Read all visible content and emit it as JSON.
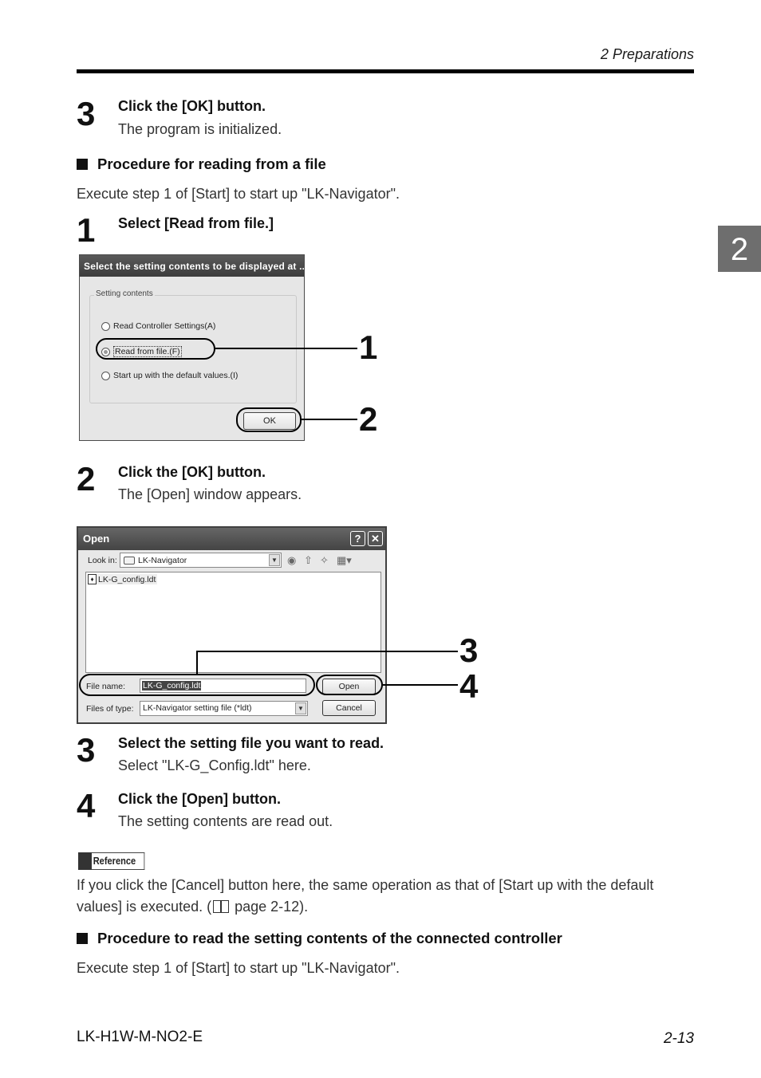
{
  "header": {
    "running_title": "2  Preparations"
  },
  "chapter_tab": {
    "number": "2"
  },
  "steps_top": [
    {
      "number": "3",
      "title": "Click the [OK] button.",
      "desc": "The program is initialized."
    }
  ],
  "section_file": {
    "heading": "Procedure for reading from a file",
    "intro": "Execute step 1 of [Start] to start up \"LK-Navigator\".",
    "step1": {
      "number": "1",
      "title": "Select [Read from file.]"
    },
    "step2": {
      "number": "2",
      "title": "Click the [OK] button.",
      "desc": "The [Open] window appears."
    },
    "step3": {
      "number": "3",
      "title": "Select the setting file you want to read.",
      "desc": "Select \"LK-G_Config.ldt\" here."
    },
    "step4": {
      "number": "4",
      "title": "Click the [Open] button.",
      "desc": "The setting contents are read out."
    }
  },
  "dialog_select": {
    "title": "Select the setting contents to be displayed at ...",
    "group_label": "Setting contents",
    "options": [
      {
        "label": "Read Controller Settings(A)",
        "checked": false
      },
      {
        "label": "Read from file.(F)",
        "checked": true
      },
      {
        "label": "Start up with the default values.(I)",
        "checked": false
      }
    ],
    "ok_label": "OK",
    "callouts": [
      "1",
      "2"
    ]
  },
  "dialog_open": {
    "title": "Open",
    "help_btn": "?",
    "close_btn": "✕",
    "look_in_label": "Look in:",
    "look_in_value": "LK-Navigator",
    "files": [
      "LK-G_config.ldt"
    ],
    "file_name_label": "File name:",
    "file_name_value": "LK-G_config.ldt",
    "file_type_label": "Files of type:",
    "file_type_value": "LK-Navigator setting file (*ldt)",
    "open_label": "Open",
    "cancel_label": "Cancel",
    "callouts": [
      "3",
      "4"
    ]
  },
  "reference": {
    "badge": "Reference",
    "text_part1": "If you click the [Cancel] button here, the same operation as that of [Start up with the default values] is executed. (",
    "text_part2": " page 2-12)."
  },
  "section_controller": {
    "heading": "Procedure to read the setting contents of the connected controller",
    "intro": "Execute step 1 of [Start] to start up \"LK-Navigator\"."
  },
  "footer": {
    "doc_id": "LK-H1W-M-NO2-E",
    "page": "2-13"
  }
}
